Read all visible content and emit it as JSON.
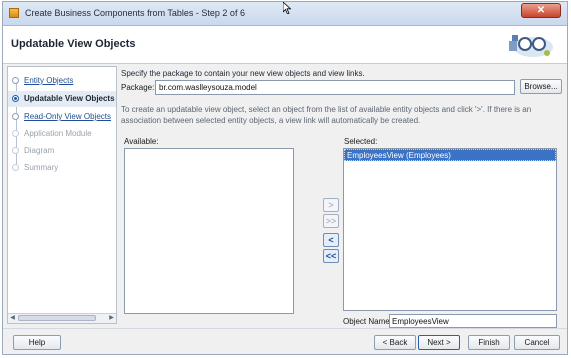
{
  "window": {
    "title": "Create Business Components from Tables - Step 2 of 6",
    "close_label": "✕"
  },
  "header": {
    "title": "Updatable View Objects"
  },
  "steps": [
    {
      "label": "Entity Objects",
      "state": "link"
    },
    {
      "label": "Updatable View Objects",
      "state": "current"
    },
    {
      "label": "Read-Only View Objects",
      "state": "link"
    },
    {
      "label": "Application Module",
      "state": "disabled"
    },
    {
      "label": "Diagram",
      "state": "disabled"
    },
    {
      "label": "Summary",
      "state": "disabled"
    }
  ],
  "main": {
    "instruction": "Specify the package to contain your new view objects and view links.",
    "package_label": "Package:",
    "package_value": "br.com.waslleysouza.model",
    "browse_label": "Browse...",
    "help_text": "To create an updatable view object, select an object from the list of available entity objects and click '>'.  If there is an association between selected entity objects, a view link will automatically be created.",
    "available_label": "Available:",
    "available_items": [],
    "selected_label": "Selected:",
    "selected_items": [
      "EmployeesView (Employees)"
    ],
    "object_name_label": "Object Name:",
    "object_name_value": "EmployeesView"
  },
  "shuttle": {
    "add": ">",
    "add_all": ">>",
    "remove": "<",
    "remove_all": "<<"
  },
  "footer": {
    "help": "Help",
    "back": "< Back",
    "next": "Next >",
    "finish": "Finish",
    "cancel": "Cancel"
  }
}
